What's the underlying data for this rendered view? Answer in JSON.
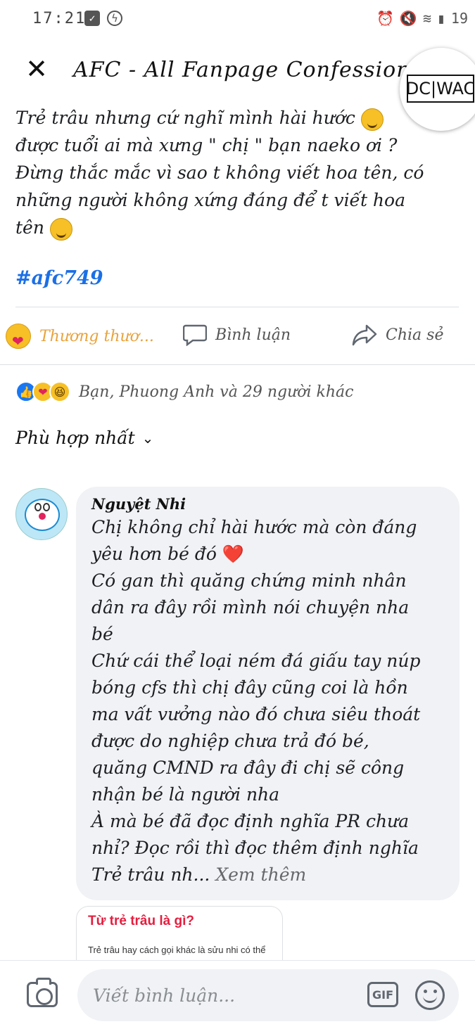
{
  "status_bar": {
    "time": "17:21",
    "battery": "19",
    "left_icons": [
      "checkbox-icon",
      "messenger-icon"
    ],
    "right_icons": [
      "alarm-icon",
      "mute-icon",
      "wifi-icon",
      "signal-icon"
    ]
  },
  "header": {
    "title": "AFC - All Fanpage Confession",
    "logo_text": "DC|WAC"
  },
  "post": {
    "lines": [
      "Trẻ trâu nhưng cứ nghĩ mình hài hước",
      "được tuổi ai mà xưng \" chị \" bạn naeko ơi ?",
      "Đừng thắc mắc vì sao t không viết hoa tên, có",
      "những người không xứng đáng để t viết hoa",
      "tên"
    ],
    "hashtag": "#afc749"
  },
  "actions": {
    "care": "Thương thươ...",
    "comment": "Bình luận",
    "share": "Chia sẻ"
  },
  "reactions": {
    "summary": "Bạn, Phuong Anh và 29 người khác"
  },
  "sort": {
    "label": "Phù hợp nhất"
  },
  "comment": {
    "author": "Nguyệt Nhi",
    "text_part1": "Chị không chỉ hài hước mà còn đáng\nyêu hơn bé đó",
    "text_part2": "Có gan thì quăng chứng minh nhân\ndân ra đây rồi mình nói chuyện nha\nbé\nChứ cái thể loại ném đá giấu tay núp\nbóng cfs thì chị đây cũng coi là hồn\nma vất vưởng nào đó chưa siêu thoát\nđược do nghiệp chưa trả đó bé,\nquăng CMND ra đây đi chị sẽ công\nnhận bé là người nha\nÀ mà bé đã đọc định nghĩa PR chưa\nnhỉ? Đọc rồi thì đọc thêm định nghĩa\nTrẻ trâu nh... ",
    "see_more": "Xem thêm"
  },
  "link_preview": {
    "title": "Từ trẻ trâu là gì?",
    "description": "Trẻ trâu hay cách gọi khác là sửu nhi có thể"
  },
  "composer": {
    "placeholder": "Viết bình luận...",
    "gif_label": "GIF"
  }
}
